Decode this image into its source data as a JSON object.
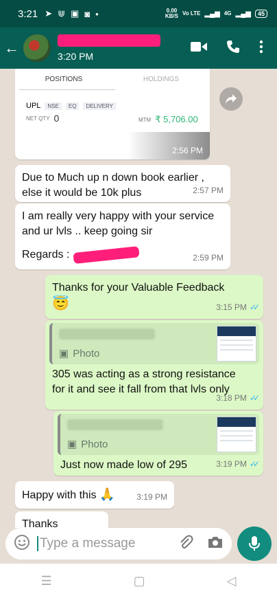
{
  "status": {
    "time": "3:21",
    "net_speed_value": "0.00",
    "net_speed_unit": "KB/S",
    "network_label": "Vo LTE",
    "signal_labels": [
      "4G"
    ],
    "battery": "45"
  },
  "header": {
    "last_seen": "3:20 PM"
  },
  "image_card": {
    "tabs": [
      "POSITIONS",
      "HOLDINGS"
    ],
    "symbol": "UPL",
    "tags": [
      "NSE",
      "EQ",
      "DELIVERY"
    ],
    "net_qty_label": "NET QTY",
    "net_qty_value": "0",
    "mtm_label": "MTM",
    "mtm_value": "₹ 5,706.00",
    "time": "2:56 PM"
  },
  "messages": [
    {
      "text": "Due to Much up n down book earlier , else it would be 10k plus",
      "time": "2:57 PM"
    },
    {
      "text": "I am really very happy with your service and ur lvls .. keep going sir",
      "regards_label": "Regards :",
      "time": "2:59 PM"
    },
    {
      "text": "Thanks for your Valuable Feedback",
      "emoji": "😇",
      "time": "3:15 PM"
    },
    {
      "quote_label": "Photo",
      "text": "305 was acting as a strong resistance for it and see it fall from that lvls only",
      "time": "3:18 PM"
    },
    {
      "quote_label": "Photo",
      "text": "Just now made low of 295",
      "time": "3:19 PM"
    },
    {
      "text": "Happy with this",
      "emoji": "🙏",
      "time": "3:19 PM"
    },
    {
      "text": "Thanks"
    }
  ],
  "composer": {
    "placeholder": "Type a message"
  },
  "colors": {
    "header": "#075e54",
    "outgoing": "#dcf8c6",
    "accent": "#128c7e",
    "read_ticks": "#34b7f1"
  }
}
